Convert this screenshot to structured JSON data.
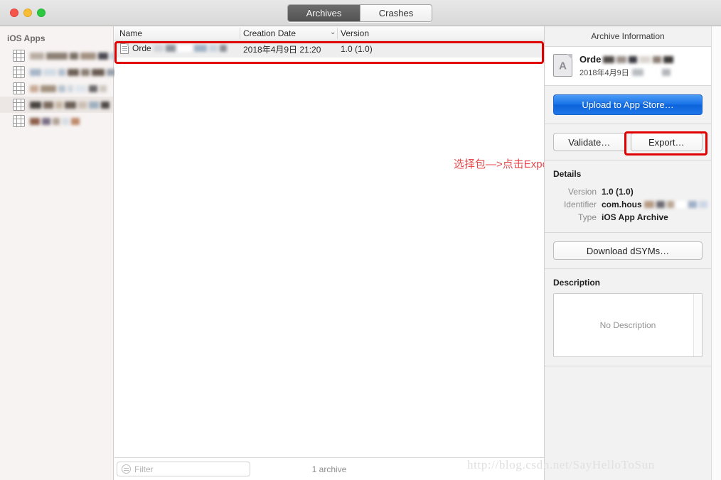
{
  "window": {
    "traffic_lights": [
      "close",
      "minimize",
      "zoom"
    ],
    "colors": {
      "close": "#f5564c",
      "minimize": "#f8bd35",
      "zoom": "#2bc940",
      "accent_blue": "#1671e8",
      "highlight_red": "#e00000",
      "annotation_red": "#e4484b"
    }
  },
  "toolbar": {
    "segments": [
      {
        "label": "Archives",
        "selected": true
      },
      {
        "label": "Crashes",
        "selected": false
      }
    ]
  },
  "sidebar": {
    "header": "iOS Apps",
    "items": [
      {
        "label": "",
        "redacted": true,
        "selected": false
      },
      {
        "label": "",
        "redacted": true,
        "selected": false
      },
      {
        "label": "",
        "redacted": true,
        "selected": false
      },
      {
        "label": "",
        "redacted": true,
        "selected": true
      },
      {
        "label": "",
        "redacted": true,
        "selected": false
      }
    ]
  },
  "archive_list": {
    "columns": [
      "Name",
      "Creation Date",
      "Version"
    ],
    "sort_indicator": "⌄",
    "rows": [
      {
        "name": "Orde",
        "name_redacted": true,
        "creation_date": "2018年4月9日 21:20",
        "version": "1.0 (1.0)",
        "selected": true
      }
    ]
  },
  "annotation": {
    "text": "选择包—>点击Export导出"
  },
  "bottom_bar": {
    "filter_placeholder": "Filter",
    "filter_value": "",
    "filter_icon": "filter-icon",
    "status": "1 archive"
  },
  "inspector": {
    "title": "Archive Information",
    "archive": {
      "name": "Orde",
      "name_redacted": true,
      "date": "2018年4月9日",
      "date_redacted": true,
      "icon": "archive-document-icon",
      "icon_glyph": "A"
    },
    "upload_button": "Upload to App Store…",
    "validate_button": "Validate…",
    "export_button": "Export…",
    "details": {
      "title": "Details",
      "rows": [
        {
          "label": "Version",
          "value": "1.0 (1.0)",
          "redacted": false
        },
        {
          "label": "Identifier",
          "value": "com.hous",
          "redacted": true
        },
        {
          "label": "Type",
          "value": "iOS App Archive",
          "redacted": false
        }
      ]
    },
    "download_dsyms_button": "Download dSYMs…",
    "description": {
      "title": "Description",
      "placeholder": "No Description",
      "value": ""
    }
  },
  "watermark": {
    "text": "http://blog.csdn.net/SayHelloToSun"
  }
}
